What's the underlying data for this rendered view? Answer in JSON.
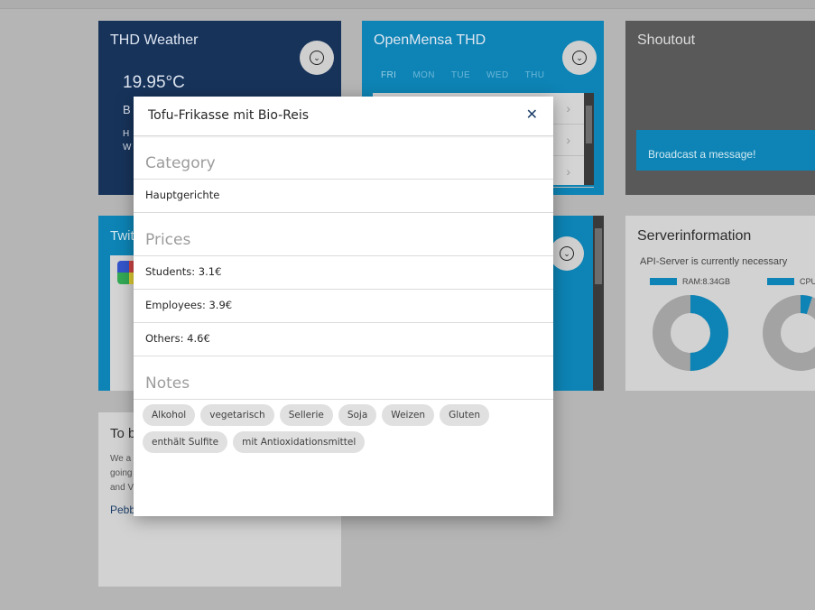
{
  "weather": {
    "title": "THD Weather",
    "temperature": "19.95°C",
    "line1": "B",
    "line2": "H",
    "line3": "W"
  },
  "mensa": {
    "title": "OpenMensa THD",
    "tabs": [
      "FRI",
      "MON",
      "TUE",
      "WED",
      "THU"
    ]
  },
  "shoutout": {
    "title": "Shoutout",
    "broadcast_label": "Broadcast a message!"
  },
  "twitter": {
    "title": "Twit"
  },
  "server": {
    "title": "Serverinformation",
    "status": "API-Server is currently necessary",
    "legend_ram": "RAM:8.34GB",
    "legend_cpu": "CPU",
    "ram_fraction": 0.5,
    "cpu_fraction": 0.05,
    "colors": {
      "used": "#0d84b5",
      "free": "#a3a3a3"
    }
  },
  "blog": {
    "title": "To b",
    "line1": "We a",
    "line2": "going",
    "line3": "and V",
    "link": "Pebb"
  },
  "modal": {
    "title": "Tofu-Frikasse mit Bio-Reis",
    "close_icon": "close-icon",
    "category_heading": "Category",
    "category_value": "Hauptgerichte",
    "prices_heading": "Prices",
    "prices": [
      {
        "label": "Students: 3.1€"
      },
      {
        "label": "Employees: 3.9€"
      },
      {
        "label": "Others: 4.6€"
      }
    ],
    "notes_heading": "Notes",
    "notes": [
      "Alkohol",
      "vegetarisch",
      "Sellerie",
      "Soja",
      "Weizen",
      "Gluten",
      "enthält Sulfite",
      "mit Antioxidationsmittel"
    ]
  }
}
